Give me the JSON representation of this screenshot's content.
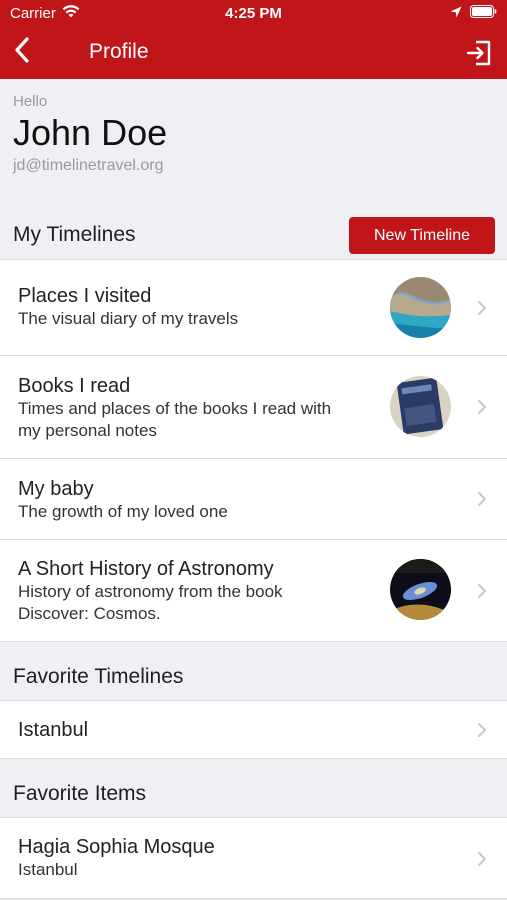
{
  "status_bar": {
    "carrier": "Carrier",
    "time": "4:25 PM"
  },
  "nav": {
    "title": "Profile"
  },
  "profile": {
    "greeting": "Hello",
    "name": "John Doe",
    "email": "jd@timelinetravel.org"
  },
  "my_timelines": {
    "header": "My Timelines",
    "new_button": "New Timeline",
    "items": [
      {
        "title": "Places I visited",
        "subtitle": "The visual diary of my travels"
      },
      {
        "title": "Books I read",
        "subtitle": "Times and places of the books I read with my personal notes"
      },
      {
        "title": "My baby",
        "subtitle": "The growth of my loved one"
      },
      {
        "title": "A Short History of Astronomy",
        "subtitle": "History of astronomy from the book Discover: Cosmos."
      }
    ]
  },
  "favorite_timelines": {
    "header": "Favorite Timelines",
    "items": [
      {
        "title": "Istanbul"
      }
    ]
  },
  "favorite_items": {
    "header": "Favorite Items",
    "items": [
      {
        "title": "Hagia Sophia Mosque",
        "subtitle": "Istanbul"
      }
    ]
  },
  "icons": {
    "back": "chevron-left-icon",
    "logout": "sign-out-icon",
    "wifi": "wifi-icon",
    "location": "location-arrow-icon",
    "battery": "battery-icon",
    "row_chevron": "chevron-right-icon"
  },
  "colors": {
    "brand_red": "#c0161a",
    "background": "#efeff4"
  }
}
